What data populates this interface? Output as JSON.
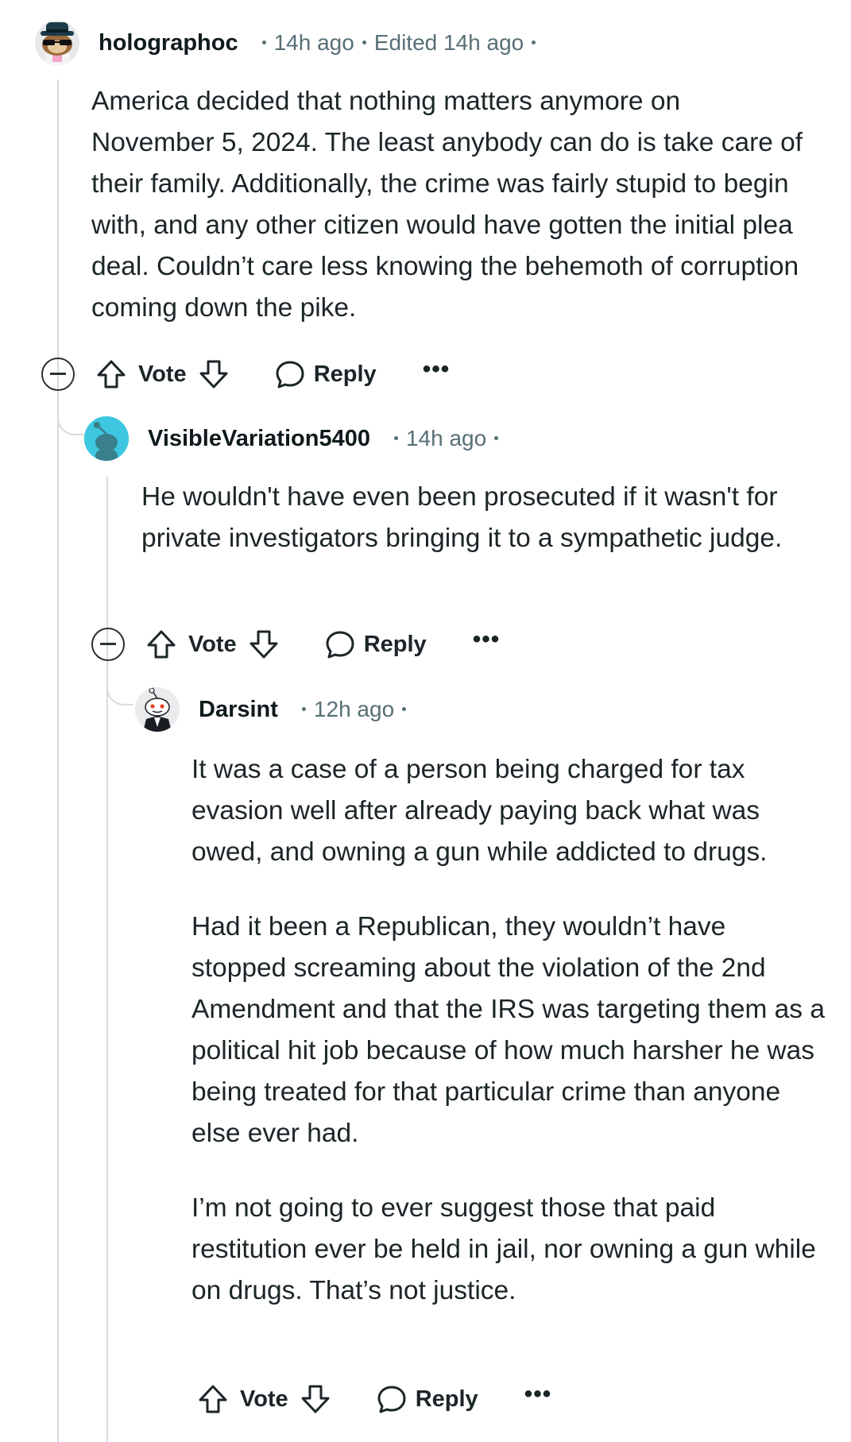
{
  "comments": [
    {
      "author": "holographoc",
      "time": "14h ago",
      "edited": "Edited 14h ago",
      "avatar_icon": "snoo-avatar-hat-glasses-icon",
      "paragraphs": [
        "America decided that nothing matters anymore on November 5, 2024. The least anybody can do is take care of their family. Additionally, the crime was fairly stupid to begin with, and any other citizen would have gotten the initial plea deal.  Couldn’t care less knowing the behemoth of corruption coming down the pike."
      ],
      "vote_label": "Vote",
      "reply_label": "Reply",
      "more_label": "•••"
    },
    {
      "author": "VisibleVariation5400",
      "time": "14h ago",
      "avatar_icon": "default-snoo-avatar-icon",
      "avatar_color": "#3ec7e0",
      "paragraphs": [
        "He wouldn't have even been prosecuted if it wasn't for private investigators bringing it to a sympathetic judge."
      ],
      "vote_label": "Vote",
      "reply_label": "Reply",
      "more_label": "•••"
    },
    {
      "author": "Darsint",
      "time": "12h ago",
      "avatar_icon": "snoo-avatar-suit-icon",
      "paragraphs": [
        "It was a case of a person being charged for tax evasion well after already paying back what was owed, and owning a gun while addicted to drugs.",
        "Had it been a Republican, they wouldn’t have stopped screaming about the violation of the 2nd Amendment and that the IRS was targeting them as a political hit job because of how much harsher he was being treated for that particular crime than anyone else ever had.",
        "I’m not going to ever suggest those that paid restitution ever be held in jail, nor owning a gun while on drugs. That’s not justice."
      ],
      "vote_label": "Vote",
      "reply_label": "Reply",
      "more_label": "•••"
    }
  ],
  "colors": {
    "text": "#1c2528",
    "meta": "#576f76",
    "thread_line": "#d9dcdd"
  }
}
